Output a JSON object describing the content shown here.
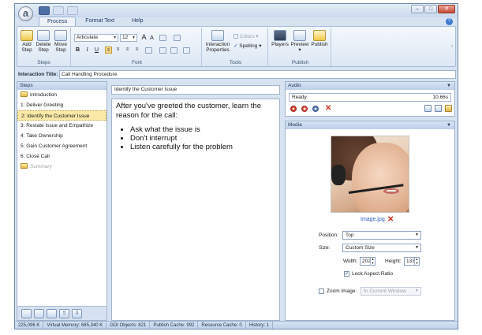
{
  "window": {
    "app_letter": "a",
    "tabs": [
      {
        "label": "Process",
        "active": true
      },
      {
        "label": "Format Text",
        "active": false
      },
      {
        "label": "Help",
        "active": false
      }
    ]
  },
  "ribbon": {
    "steps_group": {
      "label": "Steps",
      "buttons": [
        {
          "label": "Add",
          "label2": "Step"
        },
        {
          "label": "Delete",
          "label2": "Step"
        },
        {
          "label": "Move",
          "label2": "Step"
        }
      ]
    },
    "font_group": {
      "label": "Font",
      "font_name": "Articulate",
      "font_size": "12",
      "bold": "B",
      "italic": "I",
      "underline": "U",
      "grow": "A",
      "shrink": "A"
    },
    "tools_group": {
      "label": "Tools",
      "interaction_label": "Interaction",
      "interaction_label2": "Properties",
      "colors": "Colors",
      "spelling": "Spelling"
    },
    "publish_group": {
      "label": "Publish",
      "players": "Players",
      "preview": "Preview",
      "publish": "Publish"
    }
  },
  "title_row": {
    "label": "Interaction Title:",
    "value": "Call Handling Procedure"
  },
  "steps_panel": {
    "header": "Steps",
    "items": [
      {
        "label": "Introduction",
        "icon": true
      },
      {
        "label": "1:  Deliver Greeting"
      },
      {
        "label": "2:  Identify the Customer Issue",
        "selected": true
      },
      {
        "label": "3:  Restate Issue and Empathize"
      },
      {
        "label": "4:  Take Ownership"
      },
      {
        "label": "5:  Gain Customer Agreement"
      },
      {
        "label": "6:  Close Call"
      },
      {
        "label": "Summary",
        "icon": true,
        "summary": true
      }
    ]
  },
  "editor": {
    "step_title": "Identify the Customer Issue",
    "paragraph": "After you've greeted the customer, learn the reason for the call:",
    "bullets": [
      "Ask what the issue is",
      "Don't interrupt",
      "Listen carefully for the problem"
    ]
  },
  "audio_panel": {
    "header": "Audio",
    "status": "Ready",
    "duration": "10.66s"
  },
  "media_panel": {
    "header": "Media",
    "image_name": "Image.jpg",
    "position_label": "Position:",
    "position_value": "Top",
    "size_label": "Size:",
    "size_value": "Custom Size",
    "width_label": "Width:",
    "width_value": "202",
    "height_label": "Height:",
    "height_value": "133",
    "lock_label": "Lock Aspect Ratio",
    "lock_checked": true,
    "zoom_label": "Zoom Image:",
    "zoom_value": "In Current Window",
    "zoom_checked": false
  },
  "statusbar": {
    "items": [
      "225,096 K",
      "Virtual Memory: 685,340 K",
      "GDI Objects: 821",
      "Publish Cache: 992",
      "Resource Cache: 0",
      "History: 1"
    ]
  },
  "colors": {
    "accent": "#3f7ad0",
    "selection": "#fbe9a8",
    "frame": "#d7e3f1"
  }
}
